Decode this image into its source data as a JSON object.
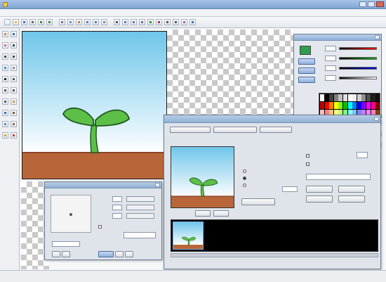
{
  "app": {
    "title": ""
  },
  "menu": [
    {
      "label": ""
    },
    {
      "label": ""
    },
    {
      "label": ""
    },
    {
      "label": ""
    },
    {
      "label": ""
    },
    {
      "label": ""
    },
    {
      "label": ""
    },
    {
      "label": ""
    },
    {
      "label": ""
    }
  ],
  "toolbar_icons": [
    {
      "icon": "new-file-icon",
      "color": "#f2f2f2"
    },
    {
      "icon": "open-folder-icon",
      "color": "#f0c04a"
    },
    {
      "icon": "save-icon",
      "color": "#4a70c0"
    },
    {
      "icon": "print-icon",
      "color": "#666666"
    },
    {
      "icon": "undo-icon",
      "color": "#3a8a3a"
    },
    {
      "icon": "redo-icon",
      "color": "#3a8a3a"
    },
    {
      "icon": "cut-icon",
      "color": "#777777"
    },
    {
      "icon": "copy-icon",
      "color": "#7790b8"
    },
    {
      "icon": "paste-icon",
      "color": "#b08a4a"
    },
    {
      "icon": "zoom-in-icon",
      "color": "#5a7ab0"
    },
    {
      "icon": "zoom-out-icon",
      "color": "#5a7ab0"
    },
    {
      "icon": "grid-icon",
      "color": "#888888"
    },
    {
      "icon": "select-icon",
      "color": "#555555"
    },
    {
      "icon": "flip-icon",
      "color": "#5a7ab0"
    },
    {
      "icon": "rotate-icon",
      "color": "#5a7ab0"
    },
    {
      "icon": "layer-icon",
      "color": "#6a6a9a"
    },
    {
      "icon": "play-icon",
      "color": "#3a8a3a"
    },
    {
      "icon": "stop-icon",
      "color": "#a04040"
    },
    {
      "icon": "frame-prev-icon",
      "color": "#555555"
    },
    {
      "icon": "frame-next-icon",
      "color": "#555555"
    },
    {
      "icon": "onion-skin-icon",
      "color": "#8a6ab0"
    },
    {
      "icon": "help-icon",
      "color": "#3a6ac0"
    }
  ],
  "tool_icons": [
    {
      "icon": "pencil-tool-icon",
      "color": "#c08a3a"
    },
    {
      "icon": "brush-tool-icon",
      "color": "#3a6ac0"
    },
    {
      "icon": "eraser-tool-icon",
      "color": "#d06a8a"
    },
    {
      "icon": "line-tool-icon",
      "color": "#444444"
    },
    {
      "icon": "rect-tool-icon",
      "color": "#444444"
    },
    {
      "icon": "ellipse-tool-icon",
      "color": "#444444"
    },
    {
      "icon": "fill-tool-icon",
      "color": "#3a8ac0"
    },
    {
      "icon": "spray-tool-icon",
      "color": "#888888"
    },
    {
      "icon": "text-tool-icon",
      "color": "#222222"
    },
    {
      "icon": "picker-tool-icon",
      "color": "#555555"
    },
    {
      "icon": "select-tool-icon",
      "color": "#555555"
    },
    {
      "icon": "move-tool-icon",
      "color": "#555555"
    },
    {
      "icon": "lasso-tool-icon",
      "color": "#555555"
    },
    {
      "icon": "hand-tool-icon",
      "color": "#c0903a"
    },
    {
      "icon": "zoom-tool-icon",
      "color": "#3a6ac0"
    },
    {
      "icon": "stamp-tool-icon",
      "color": "#7a5a3a"
    },
    {
      "icon": "blur-tool-icon",
      "color": "#6a8ab0"
    },
    {
      "icon": "smudge-tool-icon",
      "color": "#8a6a4a"
    },
    {
      "icon": "color-swap-icon",
      "color": "#d0a030"
    },
    {
      "icon": "palette-tool-icon",
      "color": "#c04040"
    }
  ],
  "color_panel": {
    "title": "",
    "current_color": "#2e9e4c",
    "channels": [
      {
        "label": "",
        "value": "",
        "bar_colors": [
          "#000000",
          "#ff0000"
        ]
      },
      {
        "label": "",
        "value": "",
        "bar_colors": [
          "#000000",
          "#00aa00"
        ]
      },
      {
        "label": "",
        "value": "",
        "bar_colors": [
          "#000000",
          "#0000ff"
        ]
      },
      {
        "label": "",
        "value": "",
        "bar_colors": [
          "#000000",
          "#ffffff"
        ]
      }
    ],
    "tabs": [
      {
        "label": ""
      },
      {
        "label": ""
      },
      {
        "label": ""
      }
    ],
    "palette": [
      "#ffffff",
      "#000000",
      "#404040",
      "#808080",
      "#c0c0c0",
      "#e0e0e0",
      "#ffffff",
      "#f0f0f0",
      "#d0d0d0",
      "#909090",
      "#505050",
      "#202020",
      "#101010",
      "#c00000",
      "#ff0000",
      "#ff8000",
      "#ffff00",
      "#80ff00",
      "#00c000",
      "#00ffff",
      "#0080ff",
      "#0000ff",
      "#8000ff",
      "#ff00ff",
      "#ff0080",
      "#800000",
      "#ffc0c0",
      "#ff8080",
      "#ffc080",
      "#ffff80",
      "#c0ff80",
      "#80ff80",
      "#80ffff",
      "#80c0ff",
      "#8080ff",
      "#c080ff",
      "#ff80ff",
      "#ff80c0",
      "#804000"
    ]
  },
  "canvas": {
    "sky_top": "#6fc6ea",
    "sky_bottom": "#ffffff",
    "ground": "#b8653a",
    "ground_dark": "#8a4426",
    "plant": "#5cc048",
    "plant_outline": "#1e5a1e"
  },
  "anim_dialog": {
    "title": "",
    "top_buttons": [
      {
        "label": ""
      },
      {
        "label": ""
      },
      {
        "label": ""
      }
    ],
    "preview_label": "",
    "info_label": "",
    "info_value": "",
    "group_label": "",
    "radio_items": [
      {
        "label": ""
      },
      {
        "label": ""
      },
      {
        "label": ""
      }
    ],
    "play_button": "",
    "stop_button": "",
    "export_button": "",
    "right_label": "",
    "checkbox_items": [
      {
        "label": ""
      },
      {
        "label": ""
      }
    ],
    "spin_value": "",
    "dropdown_value": "",
    "action_buttons": [
      {
        "label": ""
      },
      {
        "label": ""
      },
      {
        "label": ""
      },
      {
        "label": ""
      }
    ],
    "frames_label": ""
  },
  "brush_dialog": {
    "title": "",
    "fields": [
      {
        "label": "",
        "value": ""
      },
      {
        "label": "",
        "value": ""
      },
      {
        "label": "",
        "value": ""
      }
    ],
    "checkbox": "",
    "dropdown_label": "",
    "dropdown_value": "",
    "bottom_field": "",
    "buttons": [
      {
        "label": ""
      },
      {
        "label": ""
      },
      {
        "label": ""
      },
      {
        "label": ""
      },
      {
        "label": ""
      }
    ]
  },
  "statusbar": {
    "left": "",
    "right": ""
  }
}
